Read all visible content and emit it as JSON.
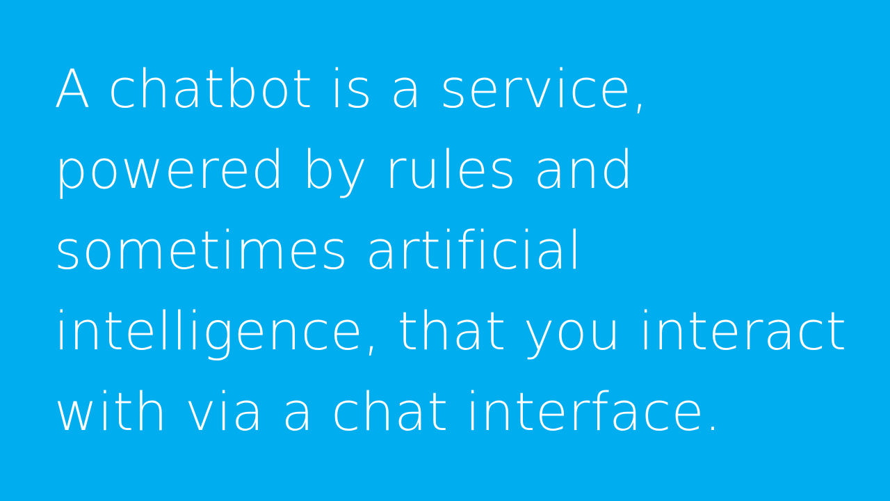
{
  "slide": {
    "background_color": "#00aeef",
    "text_color": "#ffffff",
    "lines": [
      "A chatbot is a service,",
      "powered by rules and",
      "sometimes artificial",
      "intelligence, that you interact",
      "with via a chat interface."
    ]
  }
}
